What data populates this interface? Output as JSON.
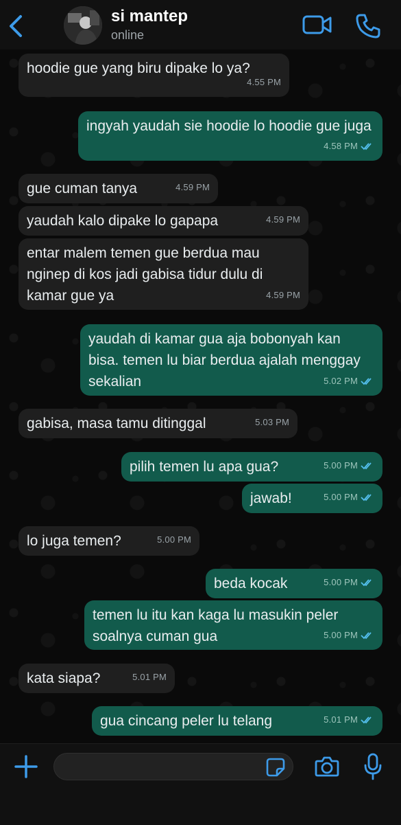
{
  "header": {
    "contact_name": "si mantep",
    "status": "online",
    "back_icon": "chevron-left-icon",
    "video_icon": "video-camera-icon",
    "call_icon": "phone-icon",
    "accent_color": "#3d9be9"
  },
  "messages": [
    {
      "direction": "in",
      "text": "hoodie gue yang biru dipake lo ya?",
      "time": "4.55 PM"
    },
    {
      "direction": "out",
      "text": "ingyah yaudah sie hoodie lo hoodie gue juga",
      "time": "4.58 PM",
      "read": true
    },
    {
      "direction": "in",
      "text": "gue cuman tanya",
      "time": "4.59 PM"
    },
    {
      "direction": "in",
      "text": "yaudah kalo dipake lo gapapa",
      "time": "4.59 PM"
    },
    {
      "direction": "in",
      "text": "entar malem temen gue berdua mau nginep di kos jadi gabisa tidur dulu di kamar gue ya",
      "time": "4.59 PM"
    },
    {
      "direction": "out",
      "text": "yaudah di kamar gua aja bobonyah kan bisa. temen lu biar berdua ajalah menggay sekalian",
      "time": "5.02 PM",
      "read": true
    },
    {
      "direction": "in",
      "text": "gabisa, masa tamu ditinggal",
      "time": "5.03 PM"
    },
    {
      "direction": "out",
      "text": "pilih temen lu apa gua?",
      "time": "5.00 PM",
      "read": true
    },
    {
      "direction": "out",
      "text": "jawab!",
      "time": "5.00 PM",
      "read": true
    },
    {
      "direction": "in",
      "text": "lo juga temen?",
      "time": "5.00 PM"
    },
    {
      "direction": "out",
      "text": "beda kocak",
      "time": "5.00 PM",
      "read": true
    },
    {
      "direction": "out",
      "text": "temen lu itu kan kaga lu masukin peler soalnya cuman gua",
      "time": "5.00 PM",
      "read": true
    },
    {
      "direction": "in",
      "text": "kata siapa?",
      "time": "5.01 PM"
    },
    {
      "direction": "out",
      "text": "gua cincang peler lu telang",
      "time": "5.01 PM",
      "read": true
    }
  ],
  "input_bar": {
    "placeholder": "",
    "plus_icon": "plus-icon",
    "sticker_icon": "sticker-icon",
    "camera_icon": "camera-icon",
    "mic_icon": "microphone-icon"
  },
  "colors": {
    "incoming_bubble": "#1f1f1f",
    "outgoing_bubble": "#125b4c",
    "read_ticks": "#53bdeb",
    "background": "#0a0a0a"
  }
}
